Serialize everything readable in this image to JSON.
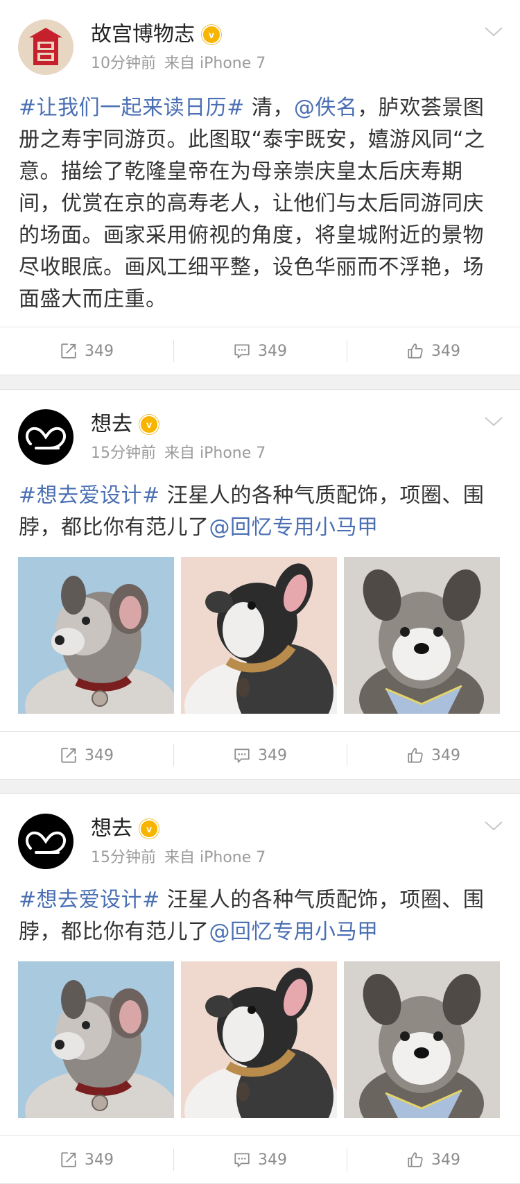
{
  "posts": [
    {
      "author": "故宫博物志",
      "time": "10分钟前",
      "source": "来自 iPhone 7",
      "content": {
        "hashtag": "#让我们一起来读日历#",
        "part1": " 清，",
        "mention": "@佚名",
        "part2": "，胪欢荟景图册之寿宇同游页。此图取“泰宇既安，嬉游风同“之意。描绘了乾隆皇帝在为母亲崇庆皇太后庆寿期间，优赏在京的高寿老人，让他们与太后同游同庆的场面。画家采用俯视的角度，将皇城附近的景物尽收眼底。画风工细平整，设色华丽而不浮艳，场面盛大而庄重。"
      },
      "repost_count": "349",
      "comment_count": "349",
      "like_count": "349"
    },
    {
      "author": "想去",
      "time": "15分钟前",
      "source": "来自 iPhone 7",
      "content": {
        "hashtag": "#想去爱设计#",
        "text": " 汪星人的各种气质配饰，项圈、围脖，都比你有范儿了",
        "mention": "@回忆专用小马甲"
      },
      "images": [
        "schnauzer-blue-background",
        "french-bulldog-pink-background",
        "schnauzer-gray-background"
      ],
      "repost_count": "349",
      "comment_count": "349",
      "like_count": "349"
    },
    {
      "author": "想去",
      "time": "15分钟前",
      "source": "来自 iPhone 7",
      "content": {
        "hashtag": "#想去爱设计#",
        "text": " 汪星人的各种气质配饰，项圈、围脖，都比你有范儿了",
        "mention": "@回忆专用小马甲"
      },
      "images": [
        "schnauzer-blue-background",
        "french-bulldog-pink-background",
        "schnauzer-gray-background"
      ],
      "repost_count": "349",
      "comment_count": "349",
      "like_count": "349"
    }
  ],
  "colors": {
    "link": "#4a6fb3",
    "verified_badge": "#f7b500",
    "meta_text": "#9b9b9b",
    "action_text": "#8c8c8c"
  },
  "icons": {
    "verified": "verified-badge-icon",
    "more": "chevron-down-icon",
    "repost": "repost-icon",
    "comment": "comment-icon",
    "like": "thumbs-up-icon"
  }
}
